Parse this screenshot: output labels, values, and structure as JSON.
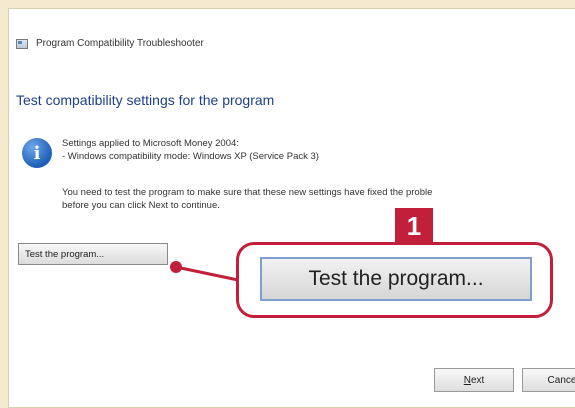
{
  "window": {
    "title": "Program Compatibility Troubleshooter"
  },
  "main": {
    "heading": "Test compatibility settings for the program",
    "applied_line1": "Settings applied to Microsoft Money 2004:",
    "applied_line2": "- Windows compatibility mode: Windows XP (Service Pack 3)",
    "note_line1": "You need to test the program to make sure that these new settings have fixed the proble",
    "note_line2": "before you can click Next to continue.",
    "test_button_label": "Test the program..."
  },
  "callout": {
    "badge_number": "1",
    "zoomed_button_label": "Test the program...",
    "accent_color": "#c2203a"
  },
  "footer": {
    "next_label_prefix": "N",
    "next_label_rest": "ext",
    "cancel_label": "Cance"
  },
  "icons": {
    "info": "info-icon",
    "app": "troubleshooter-app-icon"
  }
}
